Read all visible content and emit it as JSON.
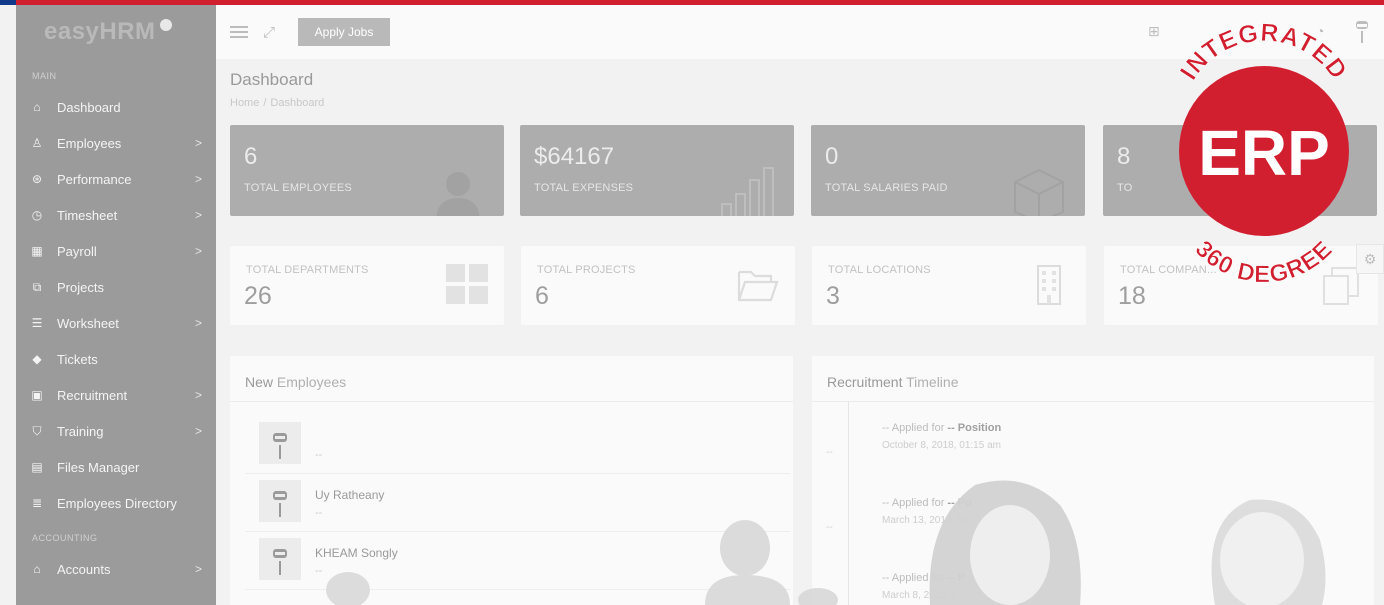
{
  "brand": {
    "name": "easyHRM"
  },
  "sidebar": {
    "sections": [
      "MAIN",
      "ACCOUNTING"
    ],
    "items": [
      {
        "label": "Dashboard",
        "icon": "home-icon",
        "chevron": false
      },
      {
        "label": "Employees",
        "icon": "user-icon",
        "chevron": true
      },
      {
        "label": "Performance",
        "icon": "performance-icon",
        "chevron": true
      },
      {
        "label": "Timesheet",
        "icon": "clock-icon",
        "chevron": true
      },
      {
        "label": "Payroll",
        "icon": "calculator-icon",
        "chevron": true
      },
      {
        "label": "Projects",
        "icon": "projects-icon",
        "chevron": false
      },
      {
        "label": "Worksheet",
        "icon": "list-icon",
        "chevron": true
      },
      {
        "label": "Tickets",
        "icon": "ticket-icon",
        "chevron": false
      },
      {
        "label": "Recruitment",
        "icon": "recruitment-icon",
        "chevron": true
      },
      {
        "label": "Training",
        "icon": "graduation-cap-icon",
        "chevron": true
      },
      {
        "label": "Files Manager",
        "icon": "file-icon",
        "chevron": false
      },
      {
        "label": "Employees Directory",
        "icon": "database-icon",
        "chevron": false
      },
      {
        "label": "Accounts",
        "icon": "bank-icon",
        "chevron": true
      }
    ],
    "chevron_glyph": ">"
  },
  "topbar": {
    "apply_jobs": "Apply Jobs"
  },
  "page": {
    "title": "Dashboard",
    "breadcrumb": [
      "Home",
      "Dashboard"
    ],
    "breadcrumb_sep": "/"
  },
  "stats": [
    {
      "value": "6",
      "label": "TOTAL EMPLOYEES",
      "icon": "user-silhouette-icon"
    },
    {
      "value": "$64167",
      "label": "TOTAL EXPENSES",
      "icon": "bar-chart-icon"
    },
    {
      "value": "0",
      "label": "TOTAL SALARIES PAID",
      "icon": "box-icon"
    },
    {
      "value": "8",
      "label": "TO",
      "icon": "none"
    }
  ],
  "stats2": [
    {
      "label": "TOTAL DEPARTMENTS",
      "value": "26",
      "icon": "grid-icon"
    },
    {
      "label": "TOTAL PROJECTS",
      "value": "6",
      "icon": "folder-open-icon"
    },
    {
      "label": "TOTAL LOCATIONS",
      "value": "3",
      "icon": "building-icon"
    },
    {
      "label": "TOTAL COMPAN...",
      "value": "18",
      "icon": "copy-icon"
    }
  ],
  "new_employees": {
    "title_bold": "New",
    "title_rest": " Employees",
    "rows": [
      {
        "name": "",
        "sub": "--"
      },
      {
        "name": "Uy Ratheany",
        "sub": "--"
      },
      {
        "name": "KHEAM Songly",
        "sub": "--"
      }
    ]
  },
  "recruitment": {
    "title_bold": "Recruitment",
    "title_rest": " Timeline",
    "rows": [
      {
        "dash": "--",
        "prefix": "-- Applied for ",
        "position": "-- Position",
        "date": "October 8, 2018, 01:15 am"
      },
      {
        "dash": "--",
        "prefix": "-- Applied for ",
        "position": "-- Po",
        "date": "March 13, 2018, 06"
      },
      {
        "dash": "--",
        "prefix": "-- Applied for ",
        "position": "-- P",
        "date": "March 8, 2018, 0"
      }
    ]
  },
  "seal": {
    "top": "INTEGRATED",
    "center": "ERP",
    "bottom": "360 DEGREE",
    "color": "#d21f30"
  },
  "colors": {
    "topline": "#d21f30",
    "corner": "#123a8a",
    "sidebar": "#9b9b9b"
  }
}
